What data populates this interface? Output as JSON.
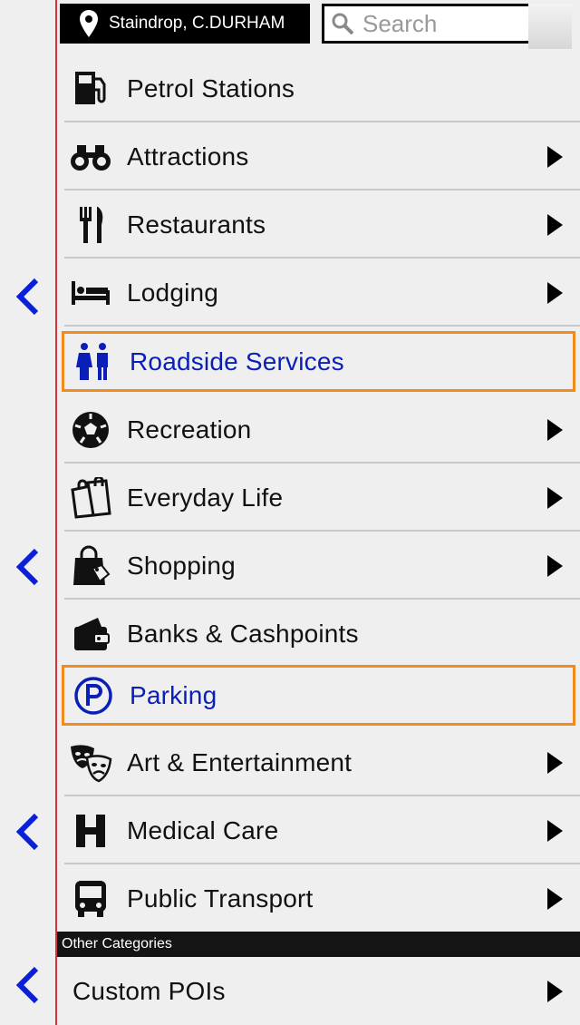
{
  "header": {
    "location_label": "Staindrop, C.DURHAM",
    "location_icon": "map-pin-icon",
    "search": {
      "placeholder": "Search",
      "value": ""
    }
  },
  "categories": [
    {
      "label": "Petrol Stations",
      "icon": "fuel-pump-icon",
      "has_submenu": false,
      "highlighted": false
    },
    {
      "label": "Attractions",
      "icon": "binoculars-icon",
      "has_submenu": true,
      "highlighted": false
    },
    {
      "label": "Restaurants",
      "icon": "fork-knife-icon",
      "has_submenu": true,
      "highlighted": false
    },
    {
      "label": "Lodging",
      "icon": "bed-icon",
      "has_submenu": true,
      "highlighted": false
    },
    {
      "label": "Roadside Services",
      "icon": "restroom-icon",
      "has_submenu": false,
      "highlighted": true
    },
    {
      "label": "Recreation",
      "icon": "soccer-ball-icon",
      "has_submenu": true,
      "highlighted": false
    },
    {
      "label": "Everyday Life",
      "icon": "shopping-bags-icon",
      "has_submenu": true,
      "highlighted": false
    },
    {
      "label": "Shopping",
      "icon": "shopping-bag-tag-icon",
      "has_submenu": true,
      "highlighted": false
    },
    {
      "label": "Banks & Cashpoints",
      "icon": "wallet-icon",
      "has_submenu": false,
      "highlighted": false
    },
    {
      "label": "Parking",
      "icon": "parking-icon",
      "has_submenu": false,
      "highlighted": true
    },
    {
      "label": "Art & Entertainment",
      "icon": "theater-masks-icon",
      "has_submenu": true,
      "highlighted": false
    },
    {
      "label": "Medical Care",
      "icon": "hospital-h-icon",
      "has_submenu": true,
      "highlighted": false
    },
    {
      "label": "Public Transport",
      "icon": "bus-icon",
      "has_submenu": true,
      "highlighted": false
    }
  ],
  "other_section": {
    "title": "Other Categories",
    "items": [
      {
        "label": "Custom POIs",
        "has_submenu": true
      }
    ]
  },
  "colors": {
    "highlight_border": "#f08c1e",
    "highlight_text": "#0a1fb8",
    "back_arrow": "#0a1fd8",
    "divider_line": "#d9313b"
  }
}
